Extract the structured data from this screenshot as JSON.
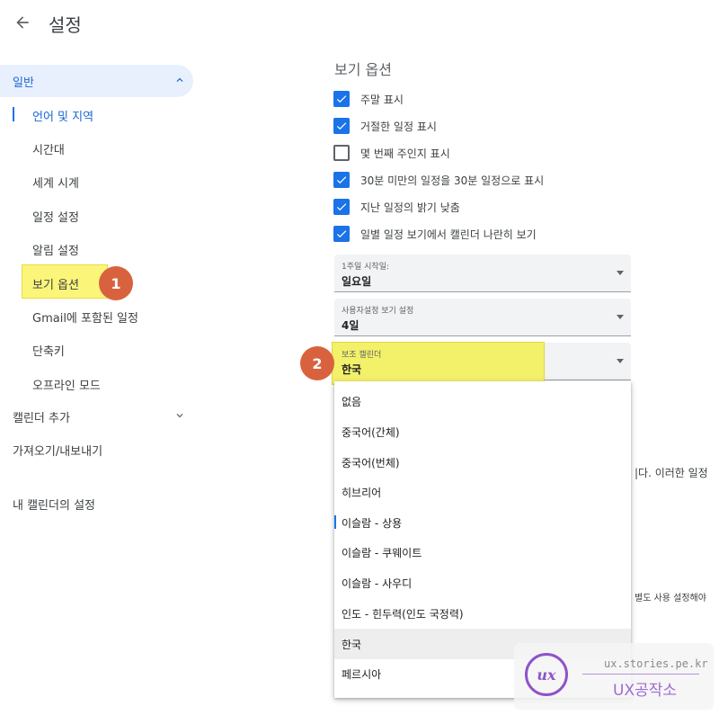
{
  "header": {
    "title": "설정"
  },
  "sidebar": {
    "general": "일반",
    "sub_items": [
      "언어 및 지역",
      "시간대",
      "세계 시계",
      "일정 설정",
      "알림 설정",
      "보기 옵션",
      "Gmail에 포함된 일정",
      "단축키",
      "오프라인 모드"
    ],
    "add_calendar": "캘린더 추가",
    "import_export": "가져오기/내보내기",
    "my_calendars": "내 캘린더의 설정"
  },
  "annotations": {
    "badge1": "1",
    "badge2": "2"
  },
  "main": {
    "section_title": "보기 옵션",
    "checkboxes": [
      {
        "label": "주말 표시",
        "checked": true
      },
      {
        "label": "거절한 일정 표시",
        "checked": true
      },
      {
        "label": "몇 번째 주인지 표시",
        "checked": false
      },
      {
        "label": "30분 미만의 일정을 30분 일정으로 표시",
        "checked": true
      },
      {
        "label": "지난 일정의 밝기 낮춤",
        "checked": true
      },
      {
        "label": "일별 일정 보기에서 캘린더 나란히 보기",
        "checked": true
      }
    ],
    "selects": [
      {
        "caption": "1주일 시작일:",
        "value": "일요일"
      },
      {
        "caption": "사용자설정 보기 설정",
        "value": "4일"
      },
      {
        "caption": "보조 캘린더",
        "value": "한국"
      }
    ],
    "dropdown_options": [
      "없음",
      "중국어(간체)",
      "중국어(번체)",
      "히브리어",
      "이슬람 - 상용",
      "이슬람 - 쿠웨이트",
      "이슬람 - 사우디",
      "인도 - 힌두력(인도 국정력)",
      "한국",
      "페르시아"
    ],
    "dropdown_selected": "한국",
    "partial_text_1": "|다. 이러한 일정",
    "partial_text_2": "별도 사용 설정해야"
  },
  "watermark": {
    "logo": "ux",
    "url": "ux.stories.pe.kr",
    "brand": "UX공작소"
  },
  "colors": {
    "accent": "#1a73e8",
    "active_bg": "#e8f0fe",
    "highlight": "#fbf57a",
    "badge": "#d9623e",
    "watermark": "#9f6ad7"
  }
}
